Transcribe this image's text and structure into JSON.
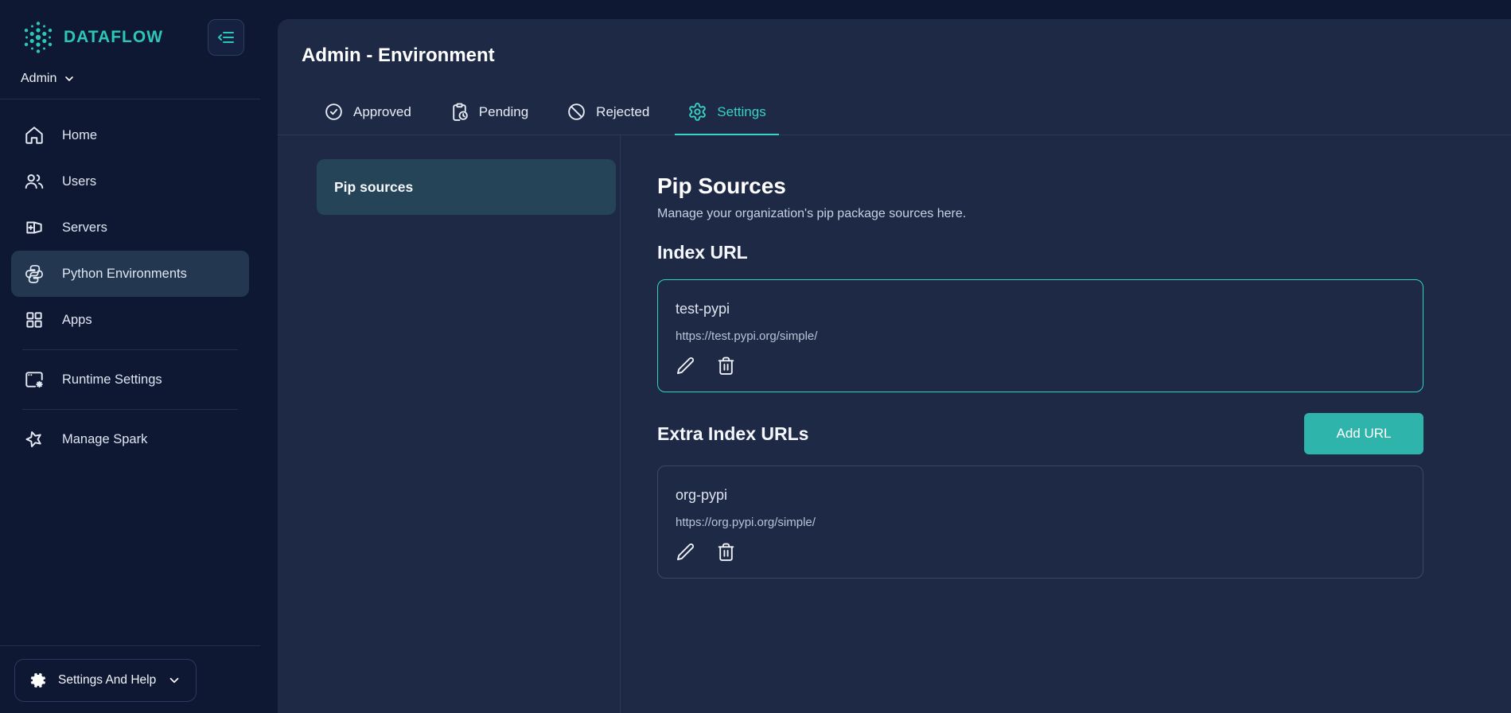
{
  "brand": {
    "name": "DATAFLOW",
    "workspace": "Admin"
  },
  "sidebar": {
    "items": [
      {
        "label": "Home"
      },
      {
        "label": "Users"
      },
      {
        "label": "Servers"
      },
      {
        "label": "Python Environments",
        "selected": true
      },
      {
        "label": "Apps"
      },
      {
        "label": "Runtime Settings"
      },
      {
        "label": "Manage Spark"
      }
    ],
    "footer_label": "Settings And Help"
  },
  "header": {
    "title": "Admin - Environment"
  },
  "tabs": [
    {
      "label": "Approved"
    },
    {
      "label": "Pending"
    },
    {
      "label": "Rejected"
    },
    {
      "label": "Settings",
      "active": true
    }
  ],
  "settings_nav": {
    "items": [
      {
        "label": "Pip sources",
        "selected": true
      }
    ]
  },
  "panel": {
    "title": "Pip Sources",
    "subtitle": "Manage your organization's pip package sources here.",
    "index_heading": "Index URL",
    "index_source": {
      "name": "test-pypi",
      "url": "https://test.pypi.org/simple/"
    },
    "extra_heading": "Extra Index URLs",
    "add_button_label": "Add URL",
    "extra_sources": [
      {
        "name": "org-pypi",
        "url": "https://org.pypi.org/simple/"
      }
    ]
  },
  "colors": {
    "accent_teal": "#2dd4bf",
    "button_teal": "#2eb4ab",
    "sidebar_bg": "#0e1833",
    "card_bg": "#1e2946",
    "selected_pill": "#254457",
    "muted_text": "#b9c3d6"
  }
}
